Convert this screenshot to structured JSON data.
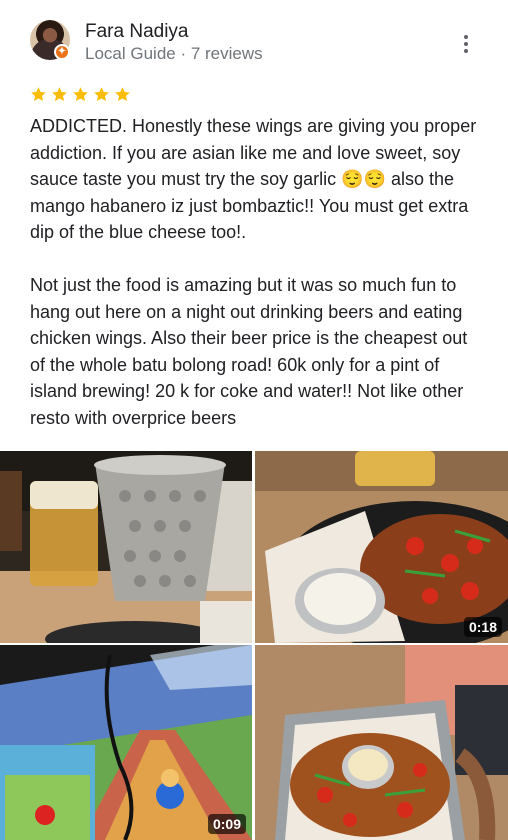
{
  "reviewer": {
    "name": "Fara Nadiya",
    "meta": "Local Guide · 7 reviews"
  },
  "rating": {
    "stars": 5,
    "max": 5,
    "color": "#fbbc04"
  },
  "review": {
    "text": "ADDICTED. Honestly these wings are giving you proper addiction. If you are asian like me and love sweet, soy sauce taste you must try the soy garlic 😌😌 also the mango habanero iz just bombaztic!! You must get extra dip of the blue cheese too!.\n\nNot just the food is amazing but it was so much fun to hang out here on a night out drinking beers and eating chicken wings. Also their beer price is the cheapest out of the whole batu bolong road! 60k only for a pint of island brewing! 20 k for coke and water!! Not like other resto with overprice beers"
  },
  "photos": [
    {
      "subject": "beer and bucket",
      "duration": ""
    },
    {
      "subject": "wings with dip",
      "duration": "0:18"
    },
    {
      "subject": "mario kart screen",
      "duration": "0:09"
    },
    {
      "subject": "wings basket",
      "duration": ""
    }
  ],
  "icons": {
    "more": "more-vert-icon",
    "badge": "local-guide-badge-icon",
    "star": "star-icon"
  }
}
